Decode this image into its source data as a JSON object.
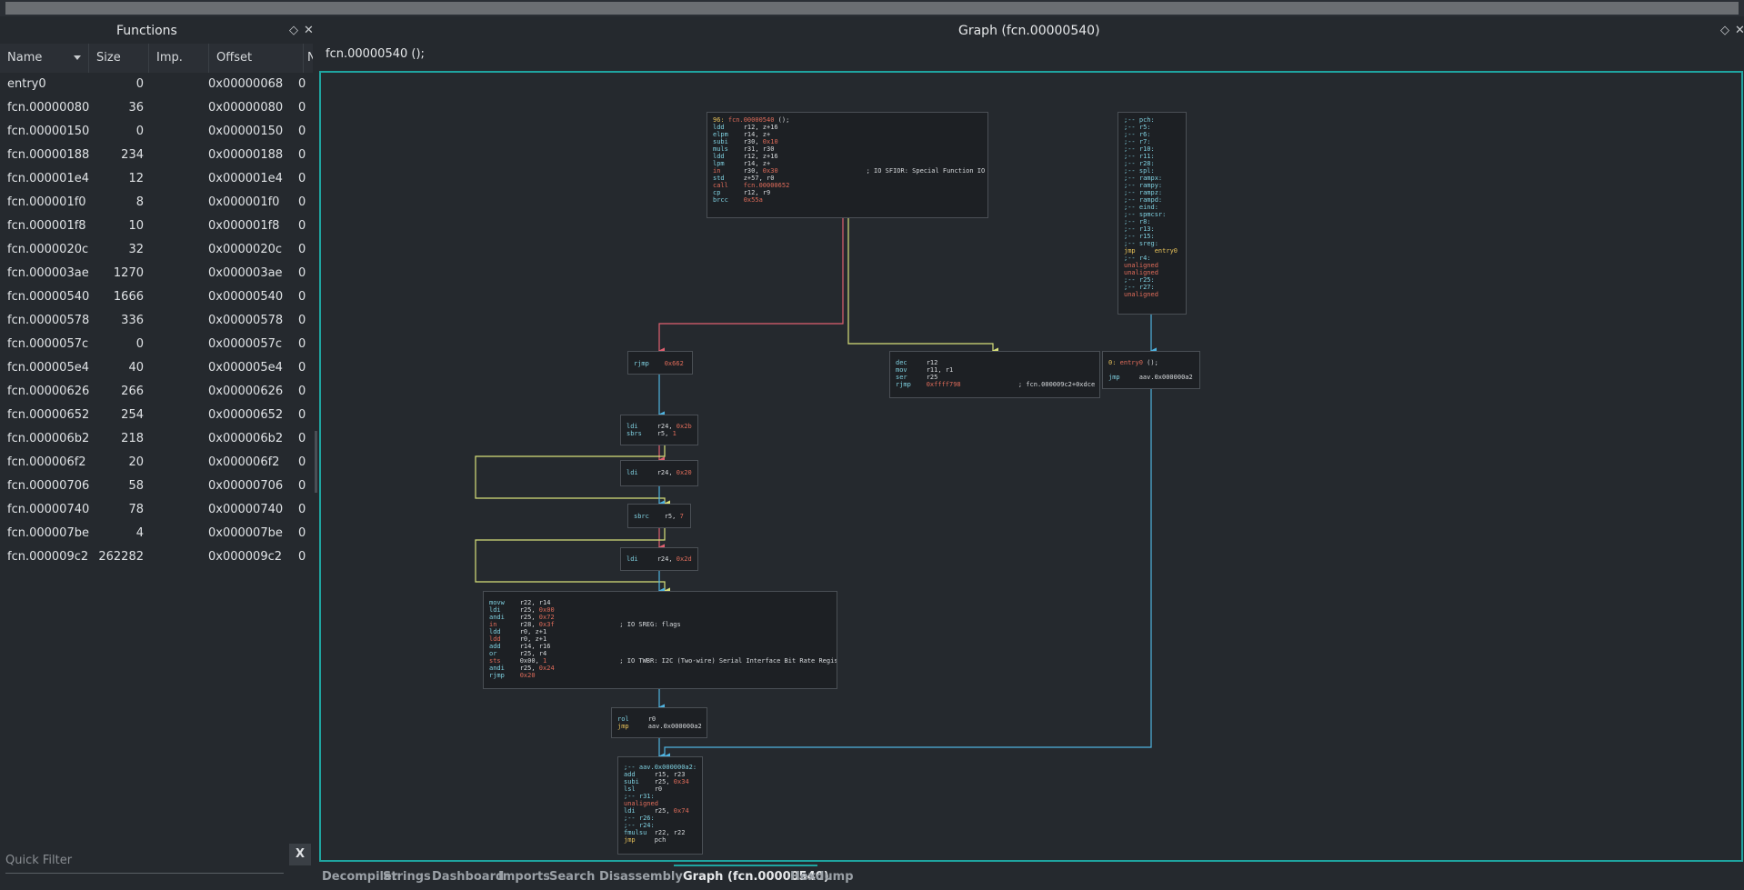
{
  "functions_panel": {
    "title": "Functions",
    "columns": [
      "Name",
      "Size",
      "Imp.",
      "Offset",
      "N"
    ],
    "rows": [
      {
        "name": "entry0",
        "size": "0",
        "offset": "0x00000068",
        "n": "0"
      },
      {
        "name": "fcn.00000080",
        "size": "36",
        "offset": "0x00000080",
        "n": "0"
      },
      {
        "name": "fcn.00000150",
        "size": "0",
        "offset": "0x00000150",
        "n": "0"
      },
      {
        "name": "fcn.00000188",
        "size": "234",
        "offset": "0x00000188",
        "n": "0"
      },
      {
        "name": "fcn.000001e4",
        "size": "12",
        "offset": "0x000001e4",
        "n": "0"
      },
      {
        "name": "fcn.000001f0",
        "size": "8",
        "offset": "0x000001f0",
        "n": "0"
      },
      {
        "name": "fcn.000001f8",
        "size": "10",
        "offset": "0x000001f8",
        "n": "0"
      },
      {
        "name": "fcn.0000020c",
        "size": "32",
        "offset": "0x0000020c",
        "n": "0"
      },
      {
        "name": "fcn.000003ae",
        "size": "1270",
        "offset": "0x000003ae",
        "n": "0"
      },
      {
        "name": "fcn.00000540",
        "size": "1666",
        "offset": "0x00000540",
        "n": "0"
      },
      {
        "name": "fcn.00000578",
        "size": "336",
        "offset": "0x00000578",
        "n": "0"
      },
      {
        "name": "fcn.0000057c",
        "size": "0",
        "offset": "0x0000057c",
        "n": "0"
      },
      {
        "name": "fcn.000005e4",
        "size": "40",
        "offset": "0x000005e4",
        "n": "0"
      },
      {
        "name": "fcn.00000626",
        "size": "266",
        "offset": "0x00000626",
        "n": "0"
      },
      {
        "name": "fcn.00000652",
        "size": "254",
        "offset": "0x00000652",
        "n": "0"
      },
      {
        "name": "fcn.000006b2",
        "size": "218",
        "offset": "0x000006b2",
        "n": "0"
      },
      {
        "name": "fcn.000006f2",
        "size": "20",
        "offset": "0x000006f2",
        "n": "0"
      },
      {
        "name": "fcn.00000706",
        "size": "58",
        "offset": "0x00000706",
        "n": "0"
      },
      {
        "name": "fcn.00000740",
        "size": "78",
        "offset": "0x00000740",
        "n": "0"
      },
      {
        "name": "fcn.000007be",
        "size": "4",
        "offset": "0x000007be",
        "n": "0"
      },
      {
        "name": "fcn.000009c2",
        "size": "262282",
        "offset": "0x000009c2",
        "n": "0"
      }
    ],
    "filter_placeholder": "Quick Filter",
    "filter_clear": "X"
  },
  "graph_panel": {
    "title": "Graph (fcn.00000540)",
    "signature": "fcn.00000540 ();",
    "blocks": {
      "b_main": [
        [
          [
            "k-lbl",
            "96: "
          ],
          [
            "k-call",
            "fcn.00000540"
          ],
          [
            "k-op",
            " ();"
          ]
        ],
        [
          [
            "k-mn",
            "ldd     "
          ],
          [
            "k-op",
            "r12, z+16"
          ]
        ],
        [
          [
            "k-mn",
            "elpm    "
          ],
          [
            "k-op",
            "r14, z+"
          ]
        ],
        [
          [
            "k-mn",
            "subi    "
          ],
          [
            "k-op",
            "r30, "
          ],
          [
            "k-num",
            "0x10"
          ]
        ],
        [
          [
            "k-mn",
            "muls    "
          ],
          [
            "k-op",
            "r31, r30"
          ]
        ],
        [
          [
            "k-mn",
            "ldd     "
          ],
          [
            "k-op",
            "r12, z+16"
          ]
        ],
        [
          [
            "k-mn",
            "lpm     "
          ],
          [
            "k-op",
            "r14, z+"
          ]
        ],
        [
          [
            "k-una",
            "in      "
          ],
          [
            "k-op",
            "r30, "
          ],
          [
            "k-num",
            "0x30"
          ],
          [
            "k-cmt",
            "                       ; IO SFIOR: Special Function IO Register"
          ]
        ],
        [
          [
            "k-mn",
            "std     "
          ],
          [
            "k-op",
            "z+57, r0"
          ]
        ],
        [
          [
            "k-call",
            "call    fcn.00000652"
          ]
        ],
        [
          [
            "k-mn",
            "cp      "
          ],
          [
            "k-op",
            "r12, r9"
          ]
        ],
        [
          [
            "k-mn",
            "brcc    "
          ],
          [
            "k-num",
            "0x55a"
          ]
        ]
      ],
      "b_regs": [
        [
          [
            "k-mn",
            ";-- pch:"
          ]
        ],
        [
          [
            "k-mn",
            ";-- r5:"
          ]
        ],
        [
          [
            "k-mn",
            ";-- r6:"
          ]
        ],
        [
          [
            "k-mn",
            ";-- r7:"
          ]
        ],
        [
          [
            "k-mn",
            ";-- r10:"
          ]
        ],
        [
          [
            "k-mn",
            ";-- r11:"
          ]
        ],
        [
          [
            "k-mn",
            ";-- r28:"
          ]
        ],
        [
          [
            "k-mn",
            ";-- spl:"
          ]
        ],
        [
          [
            "k-mn",
            ";-- rampx:"
          ]
        ],
        [
          [
            "k-mn",
            ";-- rampy:"
          ]
        ],
        [
          [
            "k-mn",
            ";-- rampz:"
          ]
        ],
        [
          [
            "k-mn",
            ";-- rampd:"
          ]
        ],
        [
          [
            "k-mn",
            ";-- eind:"
          ]
        ],
        [
          [
            "k-mn",
            ";-- spmcsr:"
          ]
        ],
        [
          [
            "k-mn",
            ";-- r8:"
          ]
        ],
        [
          [
            "k-mn",
            ";-- r13:"
          ]
        ],
        [
          [
            "k-mn",
            ";-- r15:"
          ]
        ],
        [
          [
            "k-mn",
            ";-- sreg:"
          ]
        ],
        [
          [
            "k-lbl",
            "jmp     entry0"
          ]
        ],
        [
          [
            "k-mn",
            ";-- r4:"
          ]
        ],
        [
          [
            "k-una",
            "unaligned"
          ]
        ],
        [
          [
            "k-una",
            "unaligned"
          ]
        ],
        [
          [
            "k-mn",
            ";-- r25:"
          ]
        ],
        [
          [
            "k-mn",
            ";-- r27:"
          ]
        ],
        [
          [
            "k-una",
            "unaligned"
          ]
        ]
      ],
      "b_rjmp662": [
        [
          [
            "k-mn",
            "rjmp    "
          ],
          [
            "k-num",
            "0x662"
          ]
        ]
      ],
      "b_dec": [
        [
          [
            "k-mn",
            "dec     "
          ],
          [
            "k-op",
            "r12"
          ]
        ],
        [
          [
            "k-mn",
            "mov     "
          ],
          [
            "k-op",
            "r11, r1"
          ]
        ],
        [
          [
            "k-mn",
            "ser     "
          ],
          [
            "k-op",
            "r25"
          ]
        ],
        [
          [
            "k-mn",
            "rjmp    "
          ],
          [
            "k-num",
            "0xffff798"
          ],
          [
            "k-cmt",
            "               ; fcn.000009c2+0xdce"
          ]
        ]
      ],
      "b_entry": [
        [
          [
            "k-lbl",
            "0: "
          ],
          [
            "k-call",
            "entry0"
          ],
          [
            "k-op",
            " ();"
          ]
        ],
        [
          [
            "k-op",
            " "
          ]
        ],
        [
          [
            "k-mn",
            "jmp     "
          ],
          [
            "k-op",
            "aav.0x000000a2"
          ]
        ]
      ],
      "b_ldi2b": [
        [
          [
            "k-mn",
            "ldi     "
          ],
          [
            "k-op",
            "r24, "
          ],
          [
            "k-num",
            "0x2b"
          ]
        ],
        [
          [
            "k-mn",
            "sbrs    "
          ],
          [
            "k-op",
            "r5, "
          ],
          [
            "k-num",
            "1"
          ]
        ]
      ],
      "b_ldi20": [
        [
          [
            "k-mn",
            "ldi     "
          ],
          [
            "k-op",
            "r24, "
          ],
          [
            "k-num",
            "0x20"
          ]
        ]
      ],
      "b_sbrc": [
        [
          [
            "k-mn",
            "sbrc    "
          ],
          [
            "k-op",
            "r5, "
          ],
          [
            "k-num",
            "7"
          ]
        ]
      ],
      "b_ldi2d": [
        [
          [
            "k-mn",
            "ldi     "
          ],
          [
            "k-op",
            "r24, "
          ],
          [
            "k-num",
            "0x2d"
          ]
        ]
      ],
      "b_movw": [
        [
          [
            "k-mn",
            "movw    "
          ],
          [
            "k-op",
            "r22, r14"
          ]
        ],
        [
          [
            "k-mn",
            "ldi     "
          ],
          [
            "k-op",
            "r25, "
          ],
          [
            "k-num",
            "0x00"
          ]
        ],
        [
          [
            "k-mn",
            "andi    "
          ],
          [
            "k-op",
            "r25, "
          ],
          [
            "k-num",
            "0x72"
          ]
        ],
        [
          [
            "k-una",
            "in      "
          ],
          [
            "k-op",
            "r28, "
          ],
          [
            "k-num",
            "0x3f"
          ],
          [
            "k-cmt",
            "                 ; IO SREG: flags"
          ]
        ],
        [
          [
            "k-mn",
            "ldd     "
          ],
          [
            "k-op",
            "r0, z+1"
          ]
        ],
        [
          [
            "k-una",
            "ldd     "
          ],
          [
            "k-op",
            "r0, z+1"
          ]
        ],
        [
          [
            "k-mn",
            "add     "
          ],
          [
            "k-op",
            "r14, r16"
          ]
        ],
        [
          [
            "k-mn",
            "or      "
          ],
          [
            "k-op",
            "r25, r4"
          ]
        ],
        [
          [
            "k-una",
            "sts     "
          ],
          [
            "k-op",
            "0x00, "
          ],
          [
            "k-num",
            "1"
          ],
          [
            "k-cmt",
            "                   ; IO TWBR: I2C (Two-wire) Serial Interface Bit Rate Register."
          ]
        ],
        [
          [
            "k-mn",
            "andi    "
          ],
          [
            "k-op",
            "r25, "
          ],
          [
            "k-num",
            "0x24"
          ]
        ],
        [
          [
            "k-mn",
            "rjmp    "
          ],
          [
            "k-num",
            "0x20"
          ]
        ]
      ],
      "b_rol": [
        [
          [
            "k-mn",
            "rol     "
          ],
          [
            "k-op",
            "r0"
          ]
        ],
        [
          [
            "k-lbl",
            "jmp     "
          ],
          [
            "k-op",
            "aav.0x000000a2"
          ]
        ]
      ],
      "b_aav": [
        [
          [
            "k-mn",
            ";-- aav.0x000000a2:"
          ]
        ],
        [
          [
            "k-mn",
            "add     "
          ],
          [
            "k-op",
            "r15, r23"
          ]
        ],
        [
          [
            "k-mn",
            "subi    "
          ],
          [
            "k-op",
            "r25, "
          ],
          [
            "k-num",
            "0x34"
          ]
        ],
        [
          [
            "k-mn",
            "lsl     "
          ],
          [
            "k-op",
            "r0"
          ]
        ],
        [
          [
            "k-mn",
            ";-- r31:"
          ]
        ],
        [
          [
            "k-una",
            "unaligned"
          ]
        ],
        [
          [
            "k-mn",
            "ldi     "
          ],
          [
            "k-op",
            "r25, "
          ],
          [
            "k-num",
            "0x74"
          ]
        ],
        [
          [
            "k-mn",
            ";-- r26:"
          ]
        ],
        [
          [
            "k-mn",
            ";-- r24:"
          ]
        ],
        [
          [
            "k-mn",
            "fmulsu  "
          ],
          [
            "k-op",
            "r22, r22"
          ]
        ],
        [
          [
            "k-lbl",
            "jmp     "
          ],
          [
            "k-op",
            "pch"
          ]
        ]
      ]
    }
  },
  "tabs": [
    {
      "label": "Decompiler",
      "active": false
    },
    {
      "label": "Strings",
      "active": false
    },
    {
      "label": "Dashboard",
      "active": false
    },
    {
      "label": "Imports",
      "active": false
    },
    {
      "label": "Search",
      "active": false
    },
    {
      "label": "Disassembly",
      "active": false
    },
    {
      "label": "Graph (fcn.00000540)",
      "active": true
    },
    {
      "label": "Hexdump",
      "active": false
    }
  ],
  "icons": {
    "dock": "◇",
    "close": "✕"
  },
  "colors": {
    "accent": "#1fa4a0",
    "edge_true": "#d8e07a",
    "edge_false": "#e06070",
    "edge_flow": "#4fb3e0"
  }
}
